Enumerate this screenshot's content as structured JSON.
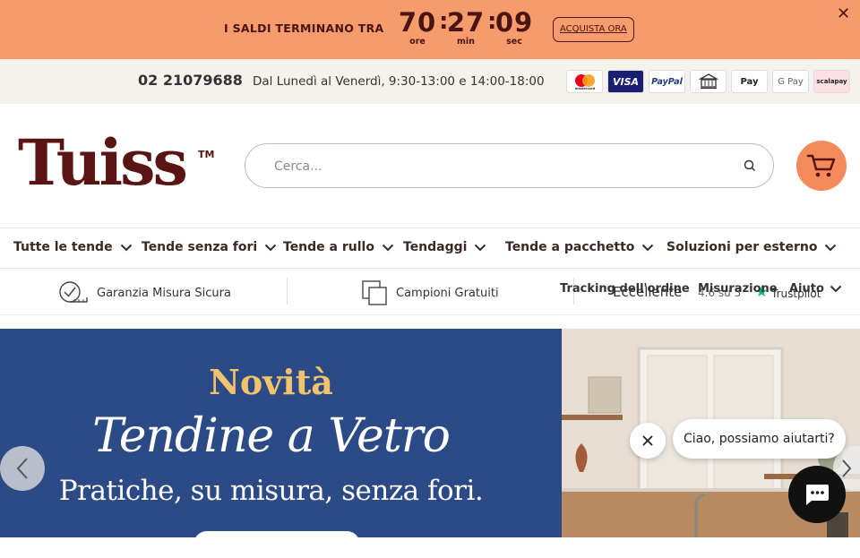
{
  "promo": {
    "text": "I SALDI TERMINANO TRA",
    "timer": {
      "hours": "70",
      "hours_label": "ore",
      "minutes": "27",
      "minutes_label": "min",
      "seconds": "09",
      "seconds_label": "sec",
      "separator": ":"
    },
    "cta": "ACQUISTA ORA",
    "close_icon": "close-icon"
  },
  "contact": {
    "phone": "02 21079688",
    "hours": "Dal Lunedì al Venerdì, 9:30-13:00 e 14:00-18:00",
    "payments": [
      {
        "name": "mastercard",
        "label": "mastercard"
      },
      {
        "name": "visa",
        "label": "VISA"
      },
      {
        "name": "paypal",
        "label": "PayPal"
      },
      {
        "name": "bank",
        "label": ""
      },
      {
        "name": "apple-pay",
        "label": " Pay"
      },
      {
        "name": "google-pay",
        "label": "G Pay"
      },
      {
        "name": "scalapay",
        "label": "scalapay"
      }
    ]
  },
  "header": {
    "logo": "Tuiss",
    "trademark": "TM",
    "search_placeholder": "Cerca...",
    "cart_icon": "cart-icon"
  },
  "nav": {
    "items": [
      {
        "label": "Tutte le tende"
      },
      {
        "label": "Tende senza fori"
      },
      {
        "label": "Tende a rullo"
      },
      {
        "label": "Tendaggi"
      },
      {
        "label": "Tende a pacchetto"
      },
      {
        "label": "Soluzioni per esterno"
      }
    ]
  },
  "features": {
    "guarantee": "Garanzia Misura Sicura",
    "samples": "Campioni Gratuiti",
    "overlap_links": {
      "tracking": "Tracking dell'ordine",
      "misurazione": "Misurazione",
      "aiuto": "Aiuto",
      "trustpilot_rating": "Eccellente",
      "trustpilot_score": "4.6 su 5",
      "trustpilot_brand": "Trustpilot"
    }
  },
  "hero": {
    "kicker": "Novità",
    "title": "Tendine a Vetro",
    "subtitle": "Pratiche, su misura, senza fori."
  },
  "chat": {
    "message": "Ciao, possiamo aiutarti?"
  },
  "colors": {
    "promo_bg": "#f59b6c",
    "brand": "#5b1414",
    "hero_bg": "#2c4a85",
    "hero_accent": "#f1c36c",
    "cart_bg": "#f58a5b"
  }
}
